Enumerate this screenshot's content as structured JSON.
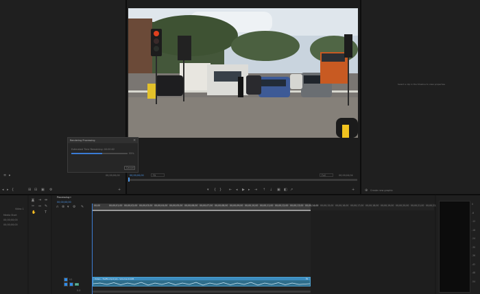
{
  "rendering": {
    "title": "Rendering Processing",
    "estimate_label": "Estimated Time Remaining: 00:00:02",
    "percent": "55%",
    "progress": 0.55,
    "cancel_label": "Cancel"
  },
  "project": {
    "rows": [
      "Video 1",
      "Media Start",
      "00;00;00;00",
      "00;00;00;00"
    ]
  },
  "source_timecodes": {
    "left": "00;00;00;00",
    "right": "00;00;00;00"
  },
  "program": {
    "timecode_left": "00;00;00;00",
    "fit_label": "Fit",
    "full_label": "Full",
    "timecode_right": "00;00;04;04"
  },
  "inspector": {
    "empty_message": "Select a clip in the timeline to view properties",
    "bottom_label": "Create new graphic"
  },
  "timeline": {
    "tab_label": "Processing",
    "playhead_timecode": "00;00;00;00",
    "ruler_labels": [
      "00;00",
      "00;00;01;00",
      "00;00;02;00",
      "00;00;03;00",
      "00;00;04;00",
      "00;00;05;00",
      "00;00;06;00",
      "00;00;07;00",
      "00;00;08;00",
      "00;00;09;00",
      "00;00;10;00",
      "00;00;11;00",
      "00;00;12;00",
      "00;00;13;00",
      "00;00;14;00",
      "00;00;15;00",
      "00;00;16;00",
      "00;00;17;00",
      "00;00;18;00",
      "00;00;19;00",
      "00;00;20;00",
      "00;00;21;00",
      "00;00;22;00"
    ],
    "audio_clip_label": "Video - Traffic.mp4 [A] - Volume:0.0dB",
    "v1_label": "V1",
    "a1_label": "A1",
    "mix_label": "0.0"
  },
  "meter_scale": [
    "0",
    "-6",
    "-12",
    "-18",
    "-24",
    "-30",
    "-36",
    "-42",
    "-48",
    "-54"
  ],
  "colors": {
    "accent": "#2d8ceb",
    "clip_audio": "#2f6e8c",
    "clip_header": "#3c8dc0",
    "progress": "#3a7bd5"
  }
}
